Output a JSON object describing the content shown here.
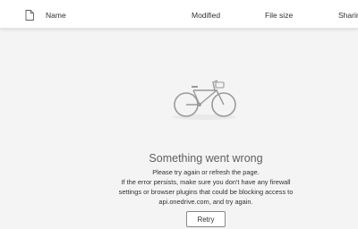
{
  "columns": {
    "name": "Name",
    "modified": "Modified",
    "file_size": "File size",
    "sharing": "Sharin"
  },
  "icons": {
    "file_type": "file-icon",
    "illustration": "bicycle-icon"
  },
  "error": {
    "title": "Something went wrong",
    "line1": "Please try again or refresh the page.",
    "line2": "If the error persists, make sure you don't have any firewall",
    "line3": "settings or browser plugins that could be blocking access to",
    "line4": "api.onedrive.com, and try again.",
    "retry_label": "Retry"
  }
}
